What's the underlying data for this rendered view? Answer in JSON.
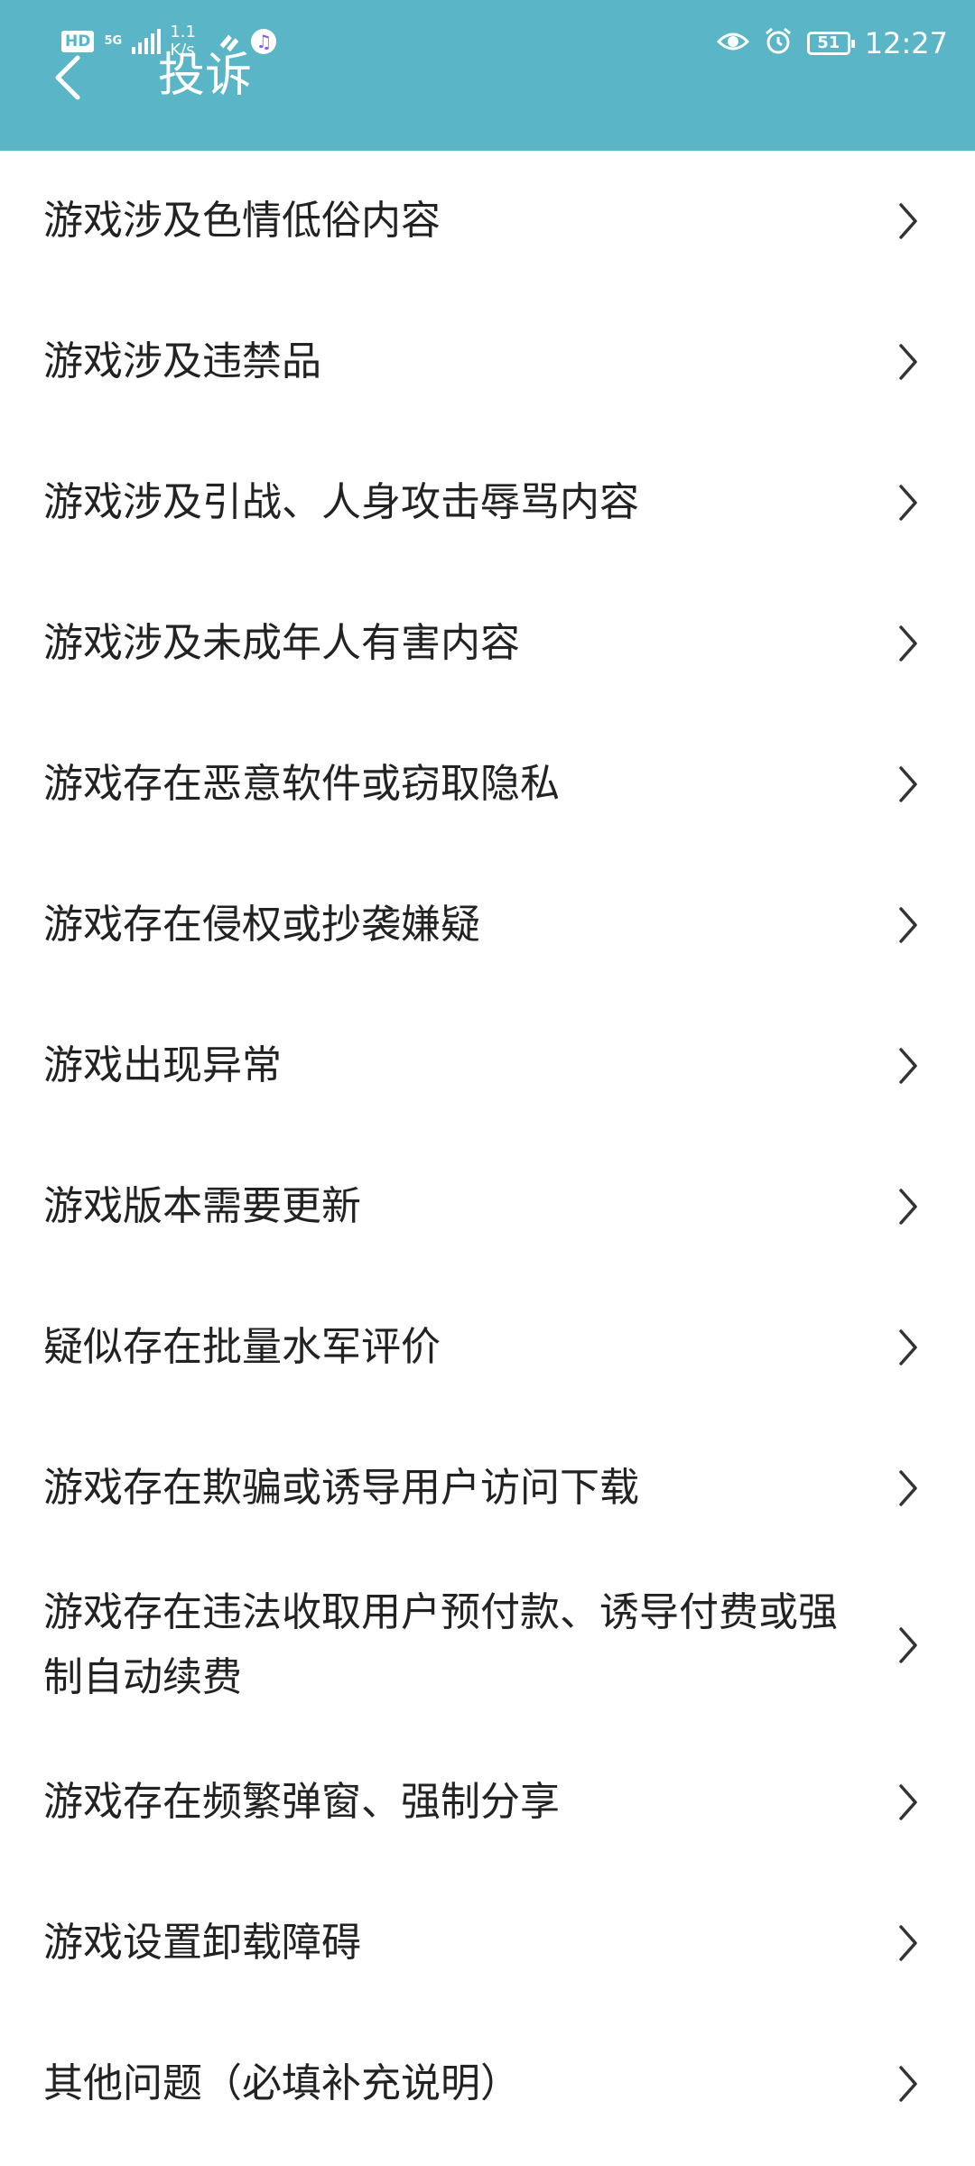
{
  "status_bar": {
    "hd": "HD",
    "network": "5G",
    "speed": "1.1 K/s",
    "battery": "51",
    "time": "12:27",
    "icons": [
      "signal-icon",
      "app-icon",
      "music-icon",
      "eye-icon",
      "alarm-icon",
      "battery-icon"
    ]
  },
  "header": {
    "title": "投诉",
    "background_color": "#5ab5c6",
    "back_icon": "chevron-left-icon"
  },
  "list": {
    "items": [
      {
        "label": "游戏涉及色情低俗内容"
      },
      {
        "label": "游戏涉及违禁品"
      },
      {
        "label": "游戏涉及引战、人身攻击辱骂内容"
      },
      {
        "label": "游戏涉及未成年人有害内容"
      },
      {
        "label": "游戏存在恶意软件或窃取隐私"
      },
      {
        "label": "游戏存在侵权或抄袭嫌疑"
      },
      {
        "label": "游戏出现异常"
      },
      {
        "label": "游戏版本需要更新"
      },
      {
        "label": "疑似存在批量水军评价"
      },
      {
        "label": "游戏存在欺骗或诱导用户访问下载"
      },
      {
        "label": "游戏存在违法收取用户预付款、诱导付费或强制自动续费"
      },
      {
        "label": "游戏存在频繁弹窗、强制分享"
      },
      {
        "label": "游戏设置卸载障碍"
      },
      {
        "label": "其他问题（必填补充说明）"
      }
    ],
    "chevron_icon": "chevron-right-icon"
  }
}
